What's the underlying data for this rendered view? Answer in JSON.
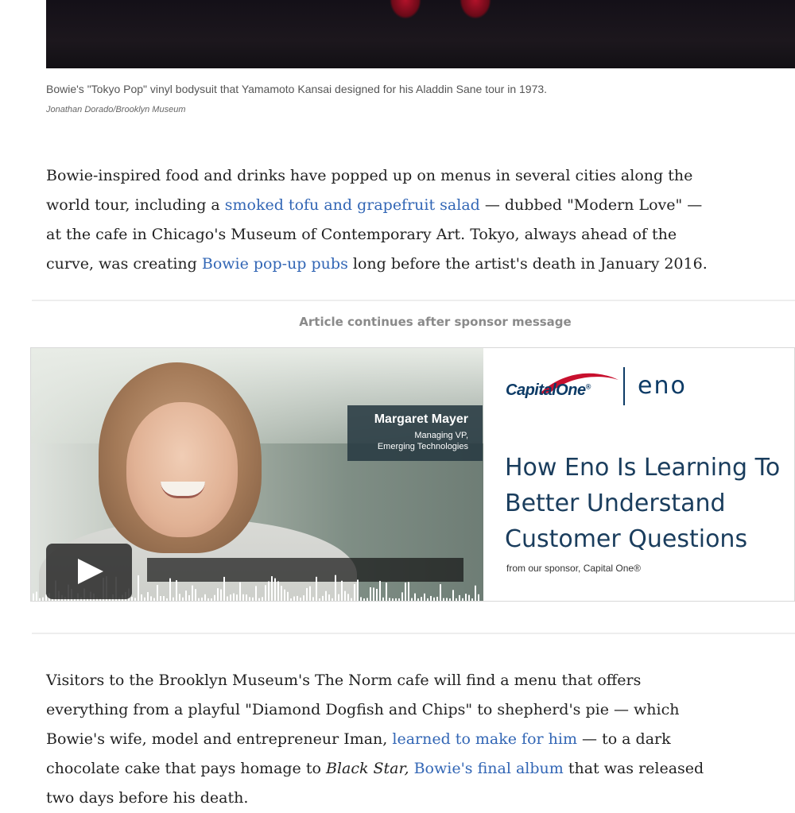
{
  "figure": {
    "image_alt": "Tokyo Pop vinyl bodysuit on display",
    "caption": "Bowie's \"Tokyo Pop\" vinyl bodysuit that Yamamoto Kansai designed for his Aladdin Sane tour in 1973.",
    "credit": "Jonathan Dorado/Brooklyn Museum"
  },
  "paragraph1": {
    "t1": "Bowie-inspired food and drinks have popped up on menus in several cities along the world tour, including a ",
    "link1": "smoked tofu and grapefruit salad",
    "t2": " — dubbed \"Modern Love\" — at the cafe in Chicago's Museum of Contemporary Art. Tokyo, always ahead of the curve, was creating ",
    "link2": "Bowie pop-up pubs",
    "t3": " long before the artist's death in January 2016."
  },
  "sponsor_label": "Article continues after sponsor message",
  "ad": {
    "person_name": "Margaret Mayer",
    "person_role_line1": "Managing VP,",
    "person_role_line2": "Emerging Technologies",
    "brand": "CapitalOne",
    "brand_mark": "®",
    "product": "eno",
    "headline": "How Eno Is Learning To Better Understand Customer Questions",
    "sponsor_line": "from our sponsor, Capital One®",
    "colors": {
      "brand_navy": "#0d3b66",
      "brand_red": "#c8102e",
      "headline": "#1a3d5d"
    },
    "icons": [
      "play-icon"
    ]
  },
  "paragraph2": {
    "t1": "Visitors to the Brooklyn Museum's The Norm cafe will find a menu that offers everything from a playful \"Diamond Dogfish and Chips\" to shepherd's pie — which Bowie's wife, model and entrepreneur Iman, ",
    "link1": "learned to make for him",
    "t2": " — to a dark chocolate cake that pays homage to ",
    "em": "Black Star,",
    "t3": " ",
    "link2": "Bowie's final album",
    "t4": " that was released two days before his death."
  },
  "colors": {
    "link": "#3266b5",
    "body_text": "#222222",
    "muted": "#8a8a8a"
  }
}
